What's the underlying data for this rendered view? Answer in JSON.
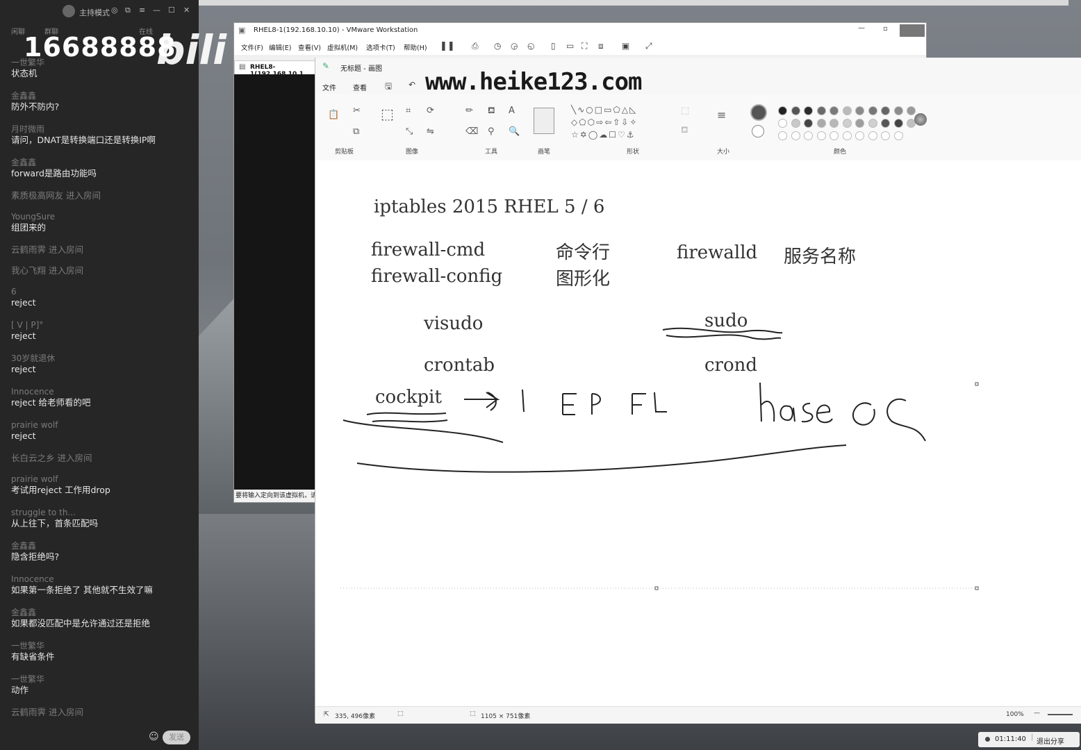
{
  "chat": {
    "mode_label": "主持模式",
    "tabs": [
      "闲聊",
      "群聊",
      "在线"
    ],
    "overlay_number": "16688888",
    "logo_text": "bili",
    "messages": [
      {
        "user": "一世繁华",
        "text": "状态机"
      },
      {
        "user": "金鑫鑫",
        "text": "防外不防内?"
      },
      {
        "user": "月时微雨",
        "text": "请问，DNAT是转换端口还是转换IP啊"
      },
      {
        "user": "金鑫鑫",
        "text": "forward是路由功能吗"
      },
      {
        "enter": "素质极高网友 进入房间"
      },
      {
        "user": "YoungSure",
        "text": "组团来的"
      },
      {
        "enter": "云鹤雨霁 进入房间"
      },
      {
        "enter": "我心飞翔 进入房间"
      },
      {
        "user": "6",
        "text": "reject"
      },
      {
        "user": "[    V        |      P]°",
        "text": "reject"
      },
      {
        "user": "30岁就退休",
        "text": "reject"
      },
      {
        "user": "Innocence",
        "text": "reject 给老师看的吧"
      },
      {
        "user": "prairie wolf",
        "text": "reject"
      },
      {
        "enter": "长白云之乡 进入房间"
      },
      {
        "user": "prairie wolf",
        "text": "考试用reject 工作用drop"
      },
      {
        "user": "struggle to th...",
        "text": "从上往下，首条匹配吗"
      },
      {
        "user": "金鑫鑫",
        "text": "隐含拒绝吗?"
      },
      {
        "user": "Innocence",
        "text": "如果第一条拒绝了 其他就不生效了嘛"
      },
      {
        "user": "金鑫鑫",
        "text": "如果都没匹配中是允许通过还是拒绝"
      },
      {
        "user": "一世繁华",
        "text": "有缺省条件"
      },
      {
        "user": "一世繁华",
        "text": "动作"
      },
      {
        "enter": "云鹤雨霁 进入房间"
      }
    ],
    "send_label": "发送"
  },
  "vmware": {
    "title": "RHEL8-1(192.168.10.10) - VMware Workstation",
    "menu": [
      "文件(F)",
      "编辑(E)",
      "查看(V)",
      "虚拟机(M)",
      "选项卡(T)",
      "帮助(H)"
    ],
    "tab_label": "RHEL8-1(192.168.10.1",
    "status_text": "要将输入定向到该虚拟机，请"
  },
  "paint": {
    "title": "无标题 - 画图",
    "tabs": [
      "文件",
      "查看"
    ],
    "ribbon_groups": [
      "剪贴板",
      "图像",
      "工具",
      "画笔",
      "形状",
      "大小",
      "颜色"
    ],
    "status_pos": "335, 496像素",
    "status_size": "1105 × 751像素",
    "zoom": "100%",
    "canvas_texts": {
      "line1": "iptables 2015 RHEL 5 / 6",
      "cmd1": "firewall-cmd",
      "cmd1_cn": "命令行",
      "cmd2": "firewall-config",
      "cmd2_cn": "图形化",
      "svc": "firewalld",
      "svc_cn": "服务名称",
      "visudo": "visudo",
      "sudo": "sudo",
      "crontab": "crontab",
      "crond": "crond",
      "cockpit": "cockpit"
    }
  },
  "watermark": "www.heike123.com",
  "taskbar": {
    "timer": "01:11:40",
    "exit_share": "退出分享"
  },
  "colors": {
    "palette_row1": [
      "#222222",
      "#555555",
      "#2b2b2b",
      "#6a6a6a",
      "#7a7a7a",
      "#bbbbbb",
      "#8a8a8a",
      "#777777",
      "#666666",
      "#8c8c8c",
      "#9a9a9a"
    ],
    "palette_row2": [
      "#ffffff",
      "#c8c8c8",
      "#444444",
      "#aaaaaa",
      "#b8b8b8",
      "#cfcfcf",
      "#9e9e9e",
      "#d0d0d0",
      "#555555",
      "#444444",
      "#c0c0c0"
    ]
  }
}
